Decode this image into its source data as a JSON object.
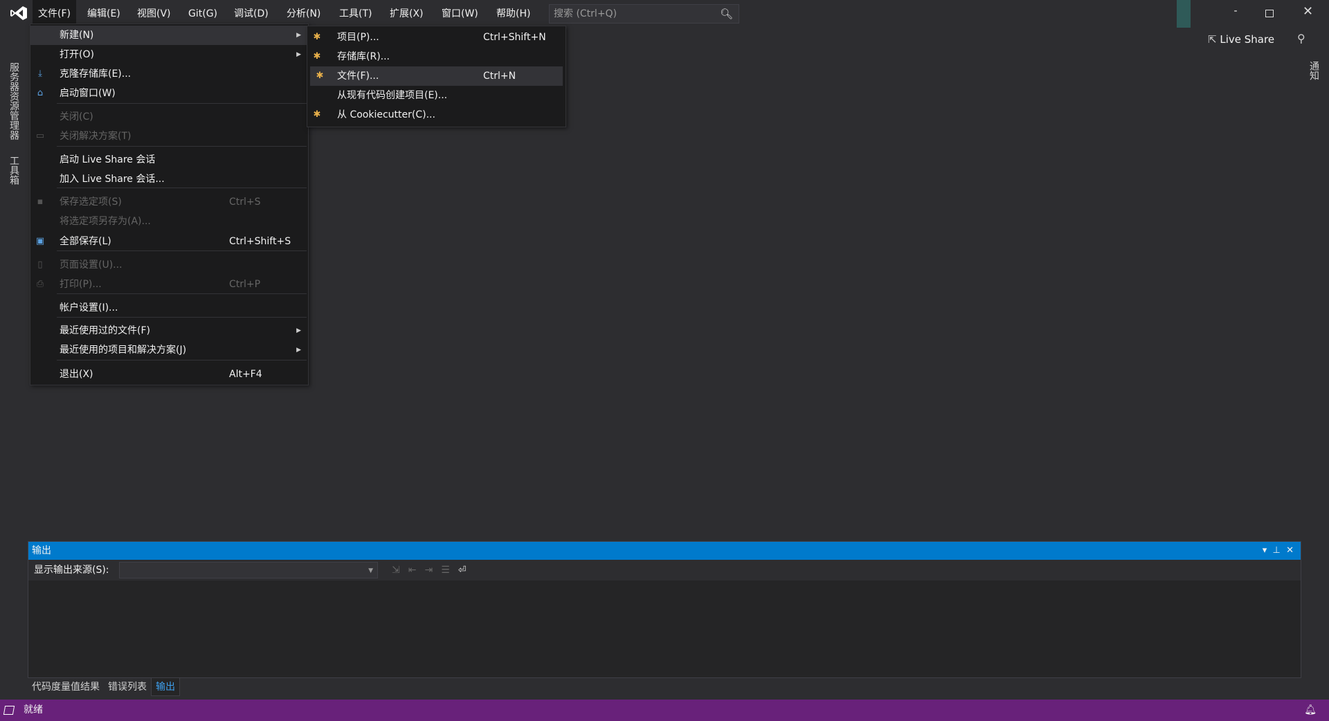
{
  "menubar": {
    "items": [
      "文件(F)",
      "编辑(E)",
      "视图(V)",
      "Git(G)",
      "调试(D)",
      "分析(N)",
      "工具(T)",
      "扩展(X)",
      "窗口(W)",
      "帮助(H)"
    ],
    "search_placeholder": "搜索 (Ctrl+Q)"
  },
  "titlebar": {
    "live_share": "Live Share",
    "minimize": "-"
  },
  "left_tabs": [
    "服务器资源管理器",
    "工具箱"
  ],
  "right_tabs": [
    "通知"
  ],
  "file_menu": [
    {
      "label": "新建(N)",
      "arrow": true,
      "icon": "none"
    },
    {
      "label": "打开(O)",
      "arrow": true
    },
    {
      "label": "克隆存储库(E)...",
      "icon": "download-icon"
    },
    {
      "label": "启动窗口(W)",
      "icon": "start-window-icon"
    },
    {
      "label": "关闭(C)",
      "disabled": true
    },
    {
      "label": "关闭解决方案(T)",
      "disabled": true,
      "icon": "close-solution-icon"
    },
    {
      "label": "启动 Live Share 会话"
    },
    {
      "label": "加入 Live Share 会话..."
    },
    {
      "label": "保存选定项(S)",
      "shortcut": "Ctrl+S",
      "disabled": true,
      "icon": "save-icon"
    },
    {
      "label": "将选定项另存为(A)...",
      "disabled": true
    },
    {
      "label": "全部保存(L)",
      "shortcut": "Ctrl+Shift+S",
      "icon": "save-all-icon"
    },
    {
      "label": "页面设置(U)...",
      "disabled": true,
      "icon": "page-setup-icon"
    },
    {
      "label": "打印(P)...",
      "shortcut": "Ctrl+P",
      "disabled": true,
      "icon": "print-icon"
    },
    {
      "label": "帐户设置(I)..."
    },
    {
      "label": "最近使用过的文件(F)",
      "arrow": true
    },
    {
      "label": "最近使用的项目和解决方案(J)",
      "arrow": true
    },
    {
      "label": "退出(X)",
      "shortcut": "Alt+F4"
    }
  ],
  "new_submenu": [
    {
      "label": "项目(P)...",
      "shortcut": "Ctrl+Shift+N",
      "icon": "new-project-icon"
    },
    {
      "label": "存储库(R)...",
      "icon": "repository-icon"
    },
    {
      "label": "文件(F)...",
      "shortcut": "Ctrl+N",
      "icon": "new-file-icon",
      "highlighted": true
    },
    {
      "label": "从现有代码创建项目(E)..."
    },
    {
      "label": "从 Cookiecutter(C)...",
      "icon": "cookiecutter-icon"
    }
  ],
  "output_panel": {
    "title": "输出",
    "source_label": "显示输出来源(S):",
    "source_value": ""
  },
  "bottom_tabs": [
    "代码度量值结果",
    "错误列表",
    "输出"
  ],
  "active_bottom_tab": "输出",
  "status": {
    "text": "就绪"
  },
  "colors": {
    "accent": "#007acc",
    "status_bar": "#68217a",
    "menu_bg": "#1b1b1c"
  }
}
